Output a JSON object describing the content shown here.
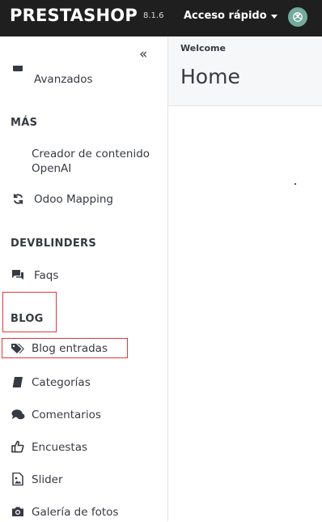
{
  "header": {
    "logo": "PRESTASHOP",
    "version": "8.1.6",
    "quick_access": "Acceso rápido"
  },
  "sidebar": {
    "items": {
      "avanzados": "Avanzados",
      "creador": "Creador de contenido OpenAI",
      "odoo": "Odoo Mapping",
      "faqs": "Faqs",
      "blog_entradas": "Blog entradas",
      "categorias": "Categorías",
      "comentarios": "Comentarios",
      "encuestas": "Encuestas",
      "slider": "Slider",
      "galeria": "Galería de fotos"
    },
    "headings": {
      "mas": "MÁS",
      "devblinders": "DEVBLINDERS",
      "blog": "BLOG"
    }
  },
  "content": {
    "breadcrumb": "Welcome",
    "title": "Home"
  },
  "colors": {
    "topbar": "#1f1f1f",
    "highlight": "#e0393e",
    "ai_icon": "#74aa9c"
  }
}
